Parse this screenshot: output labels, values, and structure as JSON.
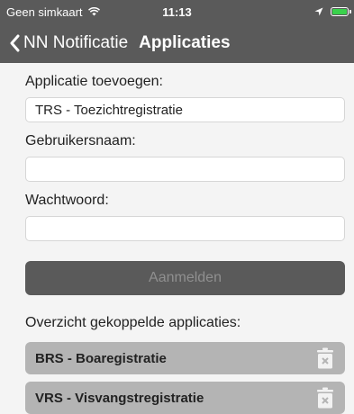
{
  "status_bar": {
    "carrier": "Geen simkaart",
    "time": "11:13"
  },
  "nav": {
    "back_label": "NN Notificatie",
    "title": "Applicaties"
  },
  "form": {
    "add_label": "Applicatie toevoegen:",
    "add_value": "TRS - Toezichtregistratie",
    "username_label": "Gebruikersnaam:",
    "username_value": "",
    "password_label": "Wachtwoord:",
    "password_value": "",
    "login_button": "Aanmelden"
  },
  "linked": {
    "heading": "Overzicht gekoppelde applicaties:",
    "apps": [
      {
        "name": "BRS - Boaregistratie"
      },
      {
        "name": "VRS - Visvangstregistratie"
      }
    ]
  },
  "colors": {
    "bar": "#5a5a5a",
    "item": "#b4b4b4",
    "battery": "#3ad14c"
  }
}
